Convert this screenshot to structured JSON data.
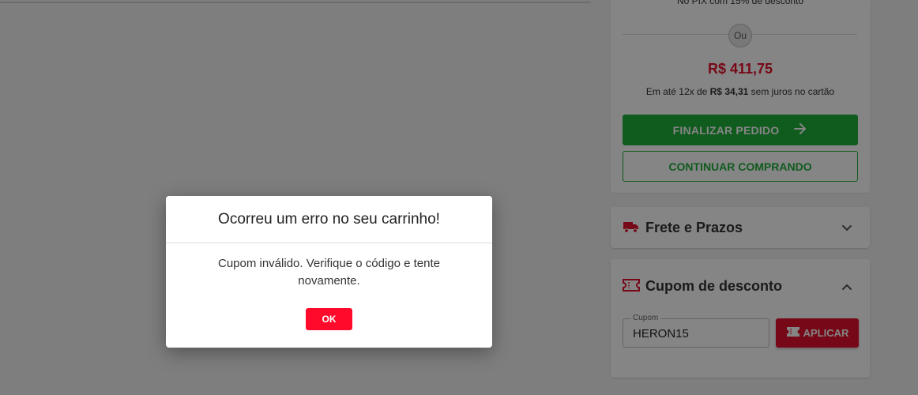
{
  "summary": {
    "pix_note": "No PIX com 15% de desconto",
    "or_label": "Ou",
    "price": "R$ 411,75",
    "installments_prefix": "Em até 12x de ",
    "installments_value": "R$ 34,31",
    "installments_suffix": " sem juros no cartão",
    "finalize_label": "FINALIZAR PEDIDO",
    "continue_label": "CONTINUAR COMPRANDO"
  },
  "shipping": {
    "title": "Frete e Prazos"
  },
  "coupon": {
    "title": "Cupom de desconto",
    "field_label": "Cupom",
    "field_value": "HERON15",
    "apply_label": "APLICAR"
  },
  "modal": {
    "title": "Ocorreu um erro no seu carrinho!",
    "message": "Cupom inválido. Verifique o código e tente novamente.",
    "ok_label": "OK"
  },
  "icons": {
    "finalize": "arrow-right-icon",
    "shipping": "truck-icon",
    "shipping_toggle": "chevron-down-icon",
    "coupon": "ticket-icon",
    "coupon_toggle": "chevron-up-icon",
    "apply": "ticket-icon"
  },
  "colors": {
    "brand_red": "#e4112d",
    "ok_red": "#ff0a2b",
    "green": "#1fae3a"
  }
}
